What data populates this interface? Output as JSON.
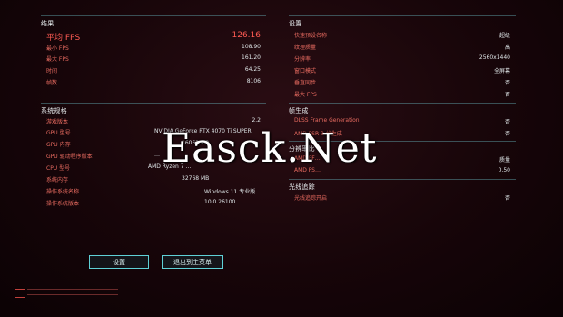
{
  "results": {
    "title": "结果",
    "avg_fps_label": "平均 FPS",
    "avg_fps": "126.16",
    "rows": [
      {
        "label": "最小 FPS",
        "value": "108.90"
      },
      {
        "label": "最大 FPS",
        "value": "161.20"
      },
      {
        "label": "时间",
        "value": "64.25"
      },
      {
        "label": "帧数",
        "value": "8106"
      }
    ]
  },
  "system": {
    "title": "系统规格",
    "rows": [
      {
        "label": "游戏版本",
        "value": "2.2"
      },
      {
        "label": "GPU 型号",
        "value": "NVIDIA GeForce RTX 4070 Ti SUPER"
      },
      {
        "label": "GPU 内存",
        "value": "16063 MB"
      },
      {
        "label": "GPU 驱动程序版本",
        "value": "…"
      },
      {
        "label": "CPU 型号",
        "value": "AMD Ryzen 7 …"
      },
      {
        "label": "系统内存",
        "value": "32768 MB"
      },
      {
        "label": "操作系统名称",
        "value": "Windows 11 专业版"
      },
      {
        "label": "操作系统版本",
        "value": "10.0.26100"
      }
    ]
  },
  "settings": {
    "title": "设置",
    "rows": [
      {
        "label": "快速预设名称",
        "value": "超级"
      },
      {
        "label": "纹理质量",
        "value": "高"
      },
      {
        "label": "分辨率",
        "value": "2560x1440"
      },
      {
        "label": "窗口模式",
        "value": "全屏幕"
      },
      {
        "label": "垂直同步",
        "value": "否"
      },
      {
        "label": "最大 FPS",
        "value": "否"
      }
    ]
  },
  "frame_gen": {
    "title": "帧生成",
    "rows": [
      {
        "label": "DLSS Frame Generation",
        "value": "否"
      },
      {
        "label": "AMD FSR 3 帧生成",
        "value": "否"
      }
    ]
  },
  "resolution": {
    "title": "分辨率比",
    "rows": [
      {
        "label": "AMD FF…",
        "value": "质量"
      },
      {
        "label": "AMD FS…",
        "value": "0.50"
      }
    ]
  },
  "raytracing": {
    "title": "光线追踪",
    "rows": [
      {
        "label": "光线追踪开启",
        "value": "否"
      }
    ]
  },
  "buttons": {
    "settings": "设置",
    "exit": "退出到主菜单"
  },
  "watermark": "Easck.Net"
}
